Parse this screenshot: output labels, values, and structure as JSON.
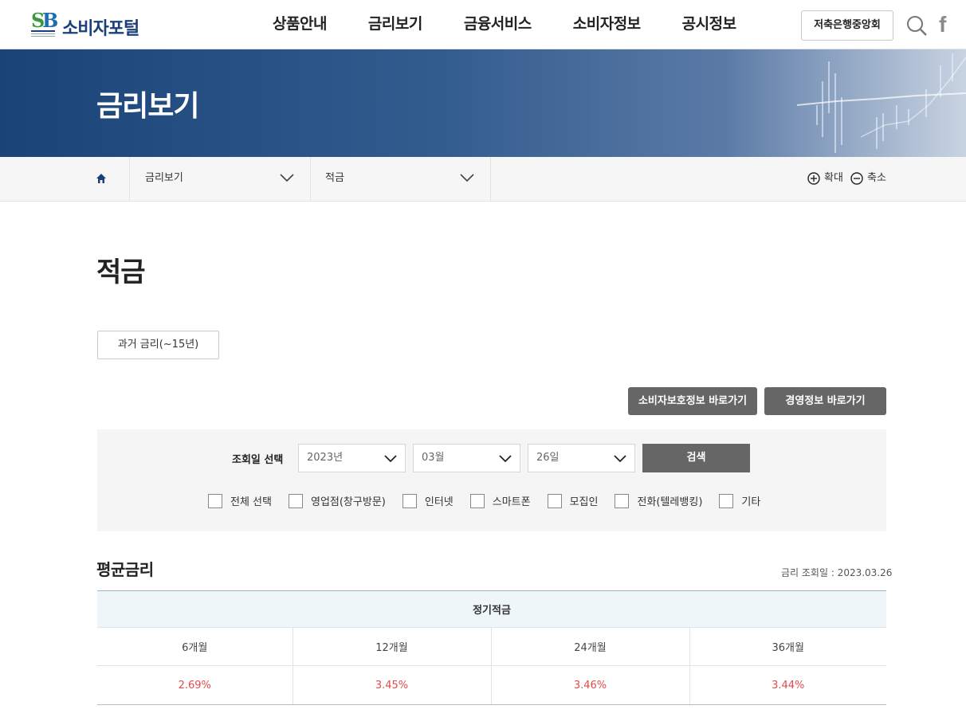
{
  "header": {
    "logo_text": "소비자포털",
    "nav": [
      "상품안내",
      "금리보기",
      "금융서비스",
      "소비자정보",
      "공시정보"
    ],
    "assoc_button": "저축은행중앙회"
  },
  "banner": {
    "title": "금리보기"
  },
  "breadcrumb": {
    "level1": "금리보기",
    "level2": "적금",
    "zoom_in": "확대",
    "zoom_out": "축소"
  },
  "page": {
    "title": "적금",
    "past_rates_button": "과거 금리(~15년)"
  },
  "actions": {
    "consumer_protection": "소비자보호정보 바로가기",
    "management_info": "경영정보 바로가기"
  },
  "filter": {
    "label": "조회일 선택",
    "year": "2023년",
    "month": "03월",
    "day": "26일",
    "search_button": "검색",
    "channels": [
      "전체 선택",
      "영업점(창구방문)",
      "인터넷",
      "스마트폰",
      "모집인",
      "전화(텔레뱅킹)",
      "기타"
    ]
  },
  "average": {
    "title": "평균금리",
    "date_text": "금리 조회일 : 2023.03.26",
    "table_header": "정기적금",
    "terms": [
      "6개월",
      "12개월",
      "24개월",
      "36개월"
    ],
    "rates": [
      "2.69%",
      "3.45%",
      "3.46%",
      "3.44%"
    ]
  },
  "colors": {
    "brand": "#1b3f7a",
    "rate": "#e24b4b",
    "button_dark": "#666666"
  }
}
